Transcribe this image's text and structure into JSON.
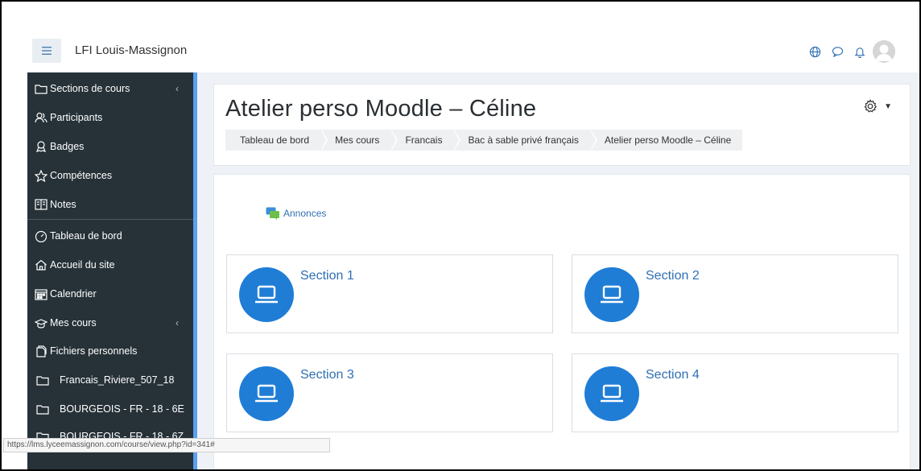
{
  "header": {
    "menu_icon": "hamburger-icon",
    "site_name": "LFI Louis-Massignon",
    "icons": [
      "globe-icon",
      "chat-icon",
      "bell-icon",
      "avatar"
    ]
  },
  "sidebar": {
    "items": [
      {
        "label": "Sections de cours",
        "icon": "folder-icon",
        "chevron": "‹"
      },
      {
        "label": "Participants",
        "icon": "participants-icon"
      },
      {
        "label": "Badges",
        "icon": "badge-icon"
      },
      {
        "label": "Compétences",
        "icon": "star-icon"
      },
      {
        "label": "Notes",
        "icon": "gradebook-icon"
      },
      {
        "label": "Tableau de bord",
        "icon": "dashboard-icon"
      },
      {
        "label": "Accueil du site",
        "icon": "home-icon"
      },
      {
        "label": "Calendrier",
        "icon": "calendar-icon"
      },
      {
        "label": "Mes cours",
        "icon": "graduation-cap-icon",
        "chevron": "‹"
      },
      {
        "label": "Fichiers personnels",
        "icon": "files-icon"
      },
      {
        "label": "Francais_Riviere_507_18",
        "icon": "folder-icon"
      },
      {
        "label": "BOURGEOIS - FR - 18 - 6E",
        "icon": "folder-icon"
      },
      {
        "label": "BOURGEOIS - FR - 18 - 6Z",
        "icon": "folder-icon"
      }
    ]
  },
  "course": {
    "title": "Atelier perso Moodle – Céline",
    "breadcrumb": [
      "Tableau de bord",
      "Mes cours",
      "Francais",
      "Bac à sable privé français",
      "Atelier perso Moodle – Céline"
    ],
    "announcements_label": "Annonces",
    "sections": [
      {
        "title": "Section 1",
        "icon": "laptop-icon"
      },
      {
        "title": "Section 2",
        "icon": "laptop-icon"
      },
      {
        "title": "Section 3",
        "icon": "laptop-icon"
      },
      {
        "title": "Section 4",
        "icon": "laptop-icon"
      }
    ]
  },
  "status_bar": {
    "url": "https://lms.lyceemassignon.com/course/view.php?id=341#"
  },
  "colors": {
    "sidebar_bg": "#263238",
    "accent_blue": "#1f7dd6",
    "link_blue": "#2f6fb3",
    "sidebar_edge": "#5aa0f0",
    "content_bg": "#eef2f6"
  }
}
